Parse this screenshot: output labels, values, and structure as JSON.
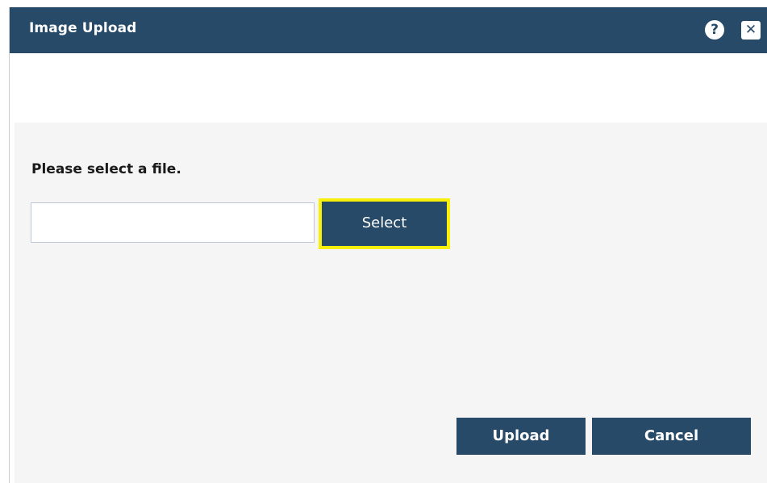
{
  "dialog": {
    "title": "Image Upload",
    "help_icon": "help-circle-icon",
    "help_glyph": "?",
    "close_icon": "close-icon",
    "close_glyph": "✕",
    "colors": {
      "header_bg": "#264a67",
      "button_bg": "#264a67",
      "focus_outline": "#f8ef0a",
      "panel_bg": "#f5f5f5"
    }
  },
  "form": {
    "prompt": "Please select a file.",
    "file_value": "",
    "select_label": "Select"
  },
  "actions": {
    "upload_label": "Upload",
    "cancel_label": "Cancel"
  }
}
